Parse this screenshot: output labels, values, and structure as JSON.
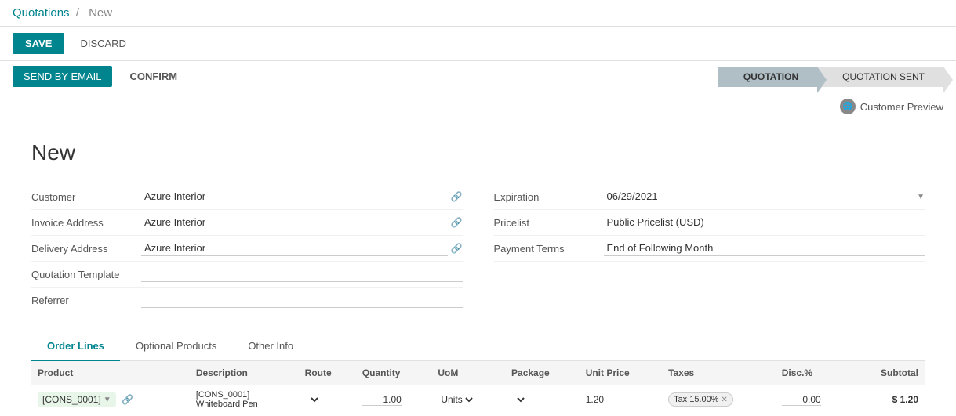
{
  "breadcrumb": {
    "parent": "Quotations",
    "current": "New",
    "separator": "/"
  },
  "toolbar": {
    "save_label": "SAVE",
    "discard_label": "DISCARD"
  },
  "workflow": {
    "send_email_label": "SEND BY EMAIL",
    "confirm_label": "CONFIRM",
    "steps": [
      {
        "id": "quotation",
        "label": "QUOTATION",
        "active": true
      },
      {
        "id": "quotation-sent",
        "label": "QUOTATION SENT",
        "active": false
      }
    ]
  },
  "customer_preview": {
    "label": "Customer Preview"
  },
  "form": {
    "title": "New",
    "left_fields": [
      {
        "id": "customer",
        "label": "Customer",
        "value": "Azure Interior",
        "type": "select-with-link"
      },
      {
        "id": "invoice_address",
        "label": "Invoice Address",
        "value": "Azure Interior",
        "type": "select-with-link"
      },
      {
        "id": "delivery_address",
        "label": "Delivery Address",
        "value": "Azure Interior",
        "type": "select-with-link"
      },
      {
        "id": "quotation_template",
        "label": "Quotation Template",
        "value": "",
        "type": "select"
      },
      {
        "id": "referrer",
        "label": "Referrer",
        "value": "",
        "type": "select"
      }
    ],
    "right_fields": [
      {
        "id": "expiration",
        "label": "Expiration",
        "value": "06/29/2021",
        "type": "select"
      },
      {
        "id": "pricelist",
        "label": "Pricelist",
        "value": "Public Pricelist (USD)",
        "type": "select"
      },
      {
        "id": "payment_terms",
        "label": "Payment Terms",
        "value": "End of Following Month",
        "type": "select"
      }
    ]
  },
  "tabs": [
    {
      "id": "order-lines",
      "label": "Order Lines",
      "active": true
    },
    {
      "id": "optional-products",
      "label": "Optional Products",
      "active": false
    },
    {
      "id": "other-info",
      "label": "Other Info",
      "active": false
    }
  ],
  "order_lines": {
    "columns": [
      "Product",
      "Description",
      "Route",
      "Quantity",
      "UoM",
      "Package",
      "Unit Price",
      "Taxes",
      "Disc.%",
      "Subtotal"
    ],
    "rows": [
      {
        "product": "[CONS_0001]",
        "description": "[CONS_0001]\nWhiteboard Pen",
        "route": "",
        "quantity": "1.00",
        "uom": "Units",
        "package": "",
        "unit_price": "1.20",
        "taxes": "Tax 15.00%",
        "disc": "0.00",
        "subtotal": "$ 1.20"
      }
    ]
  }
}
